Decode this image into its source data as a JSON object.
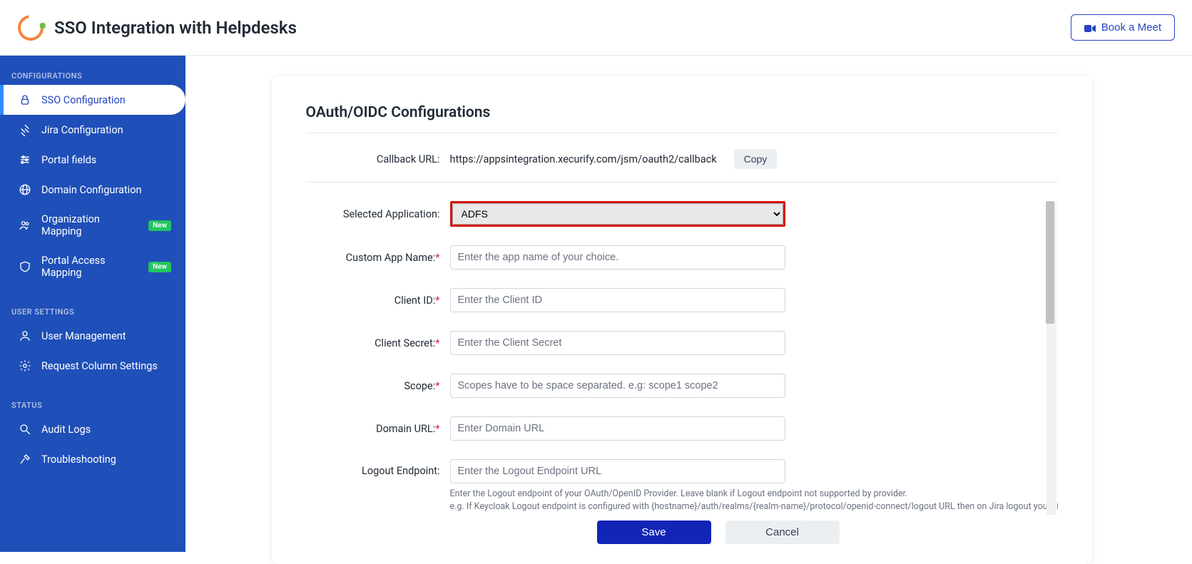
{
  "header": {
    "title": "SSO Integration with Helpdesks",
    "book_meet": "Book a Meet"
  },
  "sidebar": {
    "sections": {
      "configurations": "CONFIGURATIONS",
      "user_settings": "USER SETTINGS",
      "status": "STATUS"
    },
    "items": {
      "sso": "SSO Configuration",
      "jira": "Jira Configuration",
      "portal": "Portal fields",
      "domain": "Domain Configuration",
      "orgmap": "Organization Mapping",
      "portalaccess": "Portal Access Mapping",
      "usermgmt": "User Management",
      "reqcol": "Request Column Settings",
      "audit": "Audit Logs",
      "trouble": "Troubleshooting"
    },
    "badge_new": "New"
  },
  "panel": {
    "title": "OAuth/OIDC Configurations",
    "labels": {
      "callback": "Callback URL:",
      "selected_app": "Selected Application:",
      "app_name": "Custom App Name:",
      "client_id": "Client ID:",
      "client_secret": "Client Secret:",
      "scope": "Scope:",
      "domain_url": "Domain URL:",
      "logout_ep": "Logout Endpoint:"
    },
    "callback_value": "https://appsintegration.xecurify.com/jsm/oauth2/callback",
    "copy": "Copy",
    "selected_app_value": "ADFS",
    "placeholders": {
      "app_name": "Enter the app name of your choice.",
      "client_id": "Enter the Client ID",
      "client_secret": "Enter the Client Secret",
      "scope": "Scopes have to be space separated. e.g: scope1 scope2",
      "domain_url": "Enter Domain URL",
      "logout_ep": "Enter the Logout Endpoint URL"
    },
    "hint_line1": "Enter the Logout endpoint of your OAuth/OpenID Provider. Leave blank if Logout endpoint not supported by provider.",
    "hint_line2": "e.g. If Keycloak Logout endpoint is configured with {hostname}/auth/realms/{realm-name}/protocol/openid-connect/logout URL then on Jira logout you will get logged out",
    "save": "Save",
    "cancel": "Cancel"
  }
}
